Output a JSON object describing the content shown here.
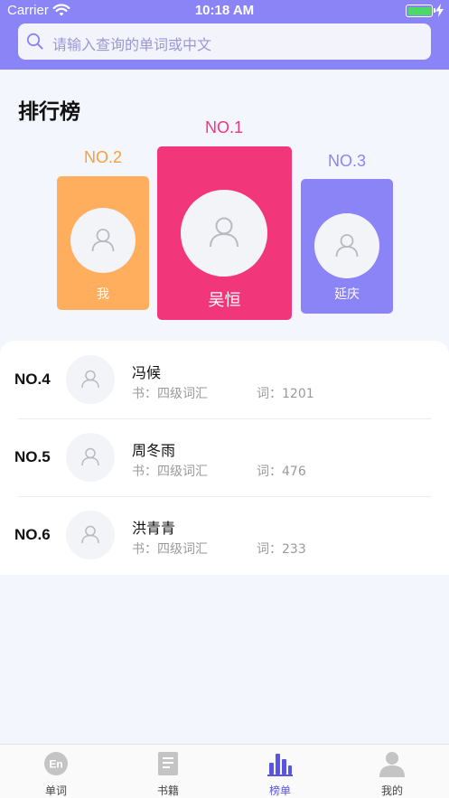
{
  "status_bar": {
    "carrier": "Carrier",
    "time": "10:18 AM"
  },
  "search": {
    "placeholder": "请输入查询的单词或中文"
  },
  "page_title": "排行榜",
  "podium": {
    "first": {
      "rank": "NO.1",
      "name": "吴恒",
      "color": "#f2367a"
    },
    "second": {
      "rank": "NO.2",
      "name": "我",
      "color": "#ffae5e"
    },
    "third": {
      "rank": "NO.3",
      "name": "延庆",
      "color": "#8b84f6"
    }
  },
  "ranking_list": [
    {
      "rank": "NO.4",
      "name": "冯候",
      "book": "书：四级词汇",
      "words": "词：1201"
    },
    {
      "rank": "NO.5",
      "name": "周冬雨",
      "book": "书：四级词汇",
      "words": "词：476"
    },
    {
      "rank": "NO.6",
      "name": "洪青青",
      "book": "书：四级词汇",
      "words": "词：233"
    }
  ],
  "tab_bar": {
    "items": [
      {
        "label": "单词",
        "icon": "en-icon"
      },
      {
        "label": "书籍",
        "icon": "book-icon"
      },
      {
        "label": "榜单",
        "icon": "ranking-icon",
        "active": true
      },
      {
        "label": "我的",
        "icon": "person-icon"
      }
    ],
    "active_color": "#5a55e0"
  },
  "colors": {
    "header": "#8b84f6",
    "background": "#f4f6fd"
  }
}
